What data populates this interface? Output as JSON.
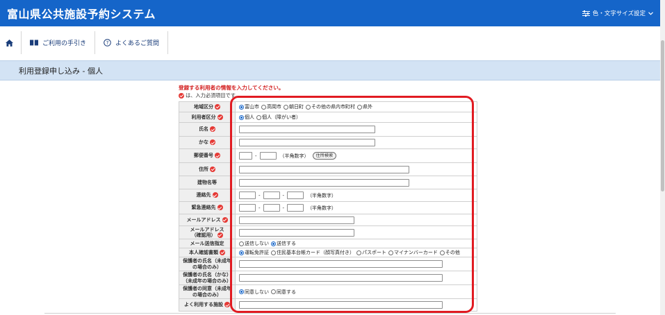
{
  "header": {
    "site_title": "富山県公共施設予約システム",
    "font_setting_label": "色・文字サイズ設定",
    "brand_color": "#1565c9"
  },
  "nav": {
    "home_icon": "home-icon",
    "guide_label": "ご利用の手引き",
    "faq_label": "よくあるご質問"
  },
  "page": {
    "heading": "利用登録申し込み - 個人",
    "instruction": "登録する利用者の情報を入力してください。",
    "required_note": "は、入力必須項目です。"
  },
  "form": {
    "region": {
      "label": "地域区分",
      "options": [
        "富山市",
        "高岡市",
        "朝日町",
        "その他の県内市町村",
        "県外"
      ],
      "selected": "富山市"
    },
    "user_type": {
      "label": "利用者区分",
      "options": [
        "個人",
        "個人（障がい者）"
      ],
      "selected": "個人"
    },
    "name": {
      "label": "氏名"
    },
    "kana": {
      "label": "かな"
    },
    "postal": {
      "label": "郵便番号",
      "hint": "（半角数字）",
      "button": "住所検索"
    },
    "address": {
      "label": "住所"
    },
    "building": {
      "label": "建物名等"
    },
    "contact": {
      "label": "連絡先",
      "hint": "（半角数字）"
    },
    "emergency": {
      "label": "緊急連絡先",
      "hint": "（半角数字）"
    },
    "email": {
      "label": "メールアドレス"
    },
    "email_confirm": {
      "label_line1": "メールアドレス",
      "label_line2": "（確認用）"
    },
    "email_send": {
      "label": "メール送信指定",
      "options": [
        "送信しない",
        "送信する"
      ],
      "selected": "送信する"
    },
    "id_doc": {
      "label": "本人確認書類",
      "options": [
        "運転免許証",
        "住民基本台帳カード（顔写真付き）",
        "パスポート",
        "マイナンバーカード",
        "その他"
      ],
      "selected": "運転免許証"
    },
    "guardian_name": {
      "label_line1": "保護者の氏名（未成年",
      "label_line2": "の場合のみ）"
    },
    "guardian_kana": {
      "label_line1": "保護者の氏名（かな）",
      "label_line2": "（未成年の場合のみ）"
    },
    "guardian_consent": {
      "label_line1": "保護者の同意（未成年",
      "label_line2": "の場合のみ）",
      "options": [
        "同意しない",
        "同意する"
      ],
      "selected": "同意しない"
    },
    "facility": {
      "label": "よく利用する施設"
    }
  },
  "highlight_color": "#e11b22"
}
